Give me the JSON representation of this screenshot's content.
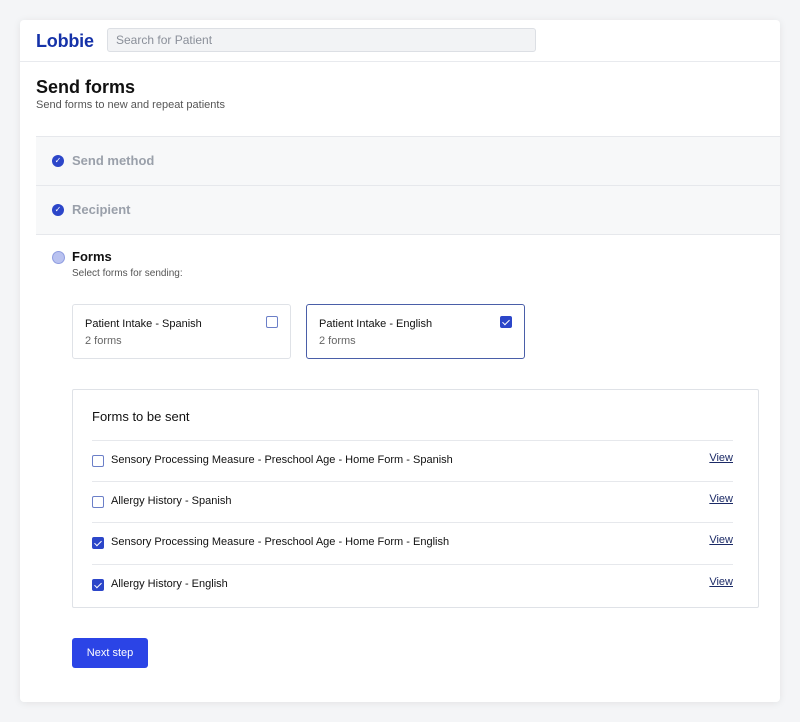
{
  "header": {
    "logo": "Lobbie",
    "search_placeholder": "Search for Patient"
  },
  "page": {
    "title": "Send forms",
    "subtitle": "Send forms to new and repeat patients"
  },
  "steps": [
    {
      "label": "Send method",
      "status": "completed"
    },
    {
      "label": "Recipient",
      "status": "completed"
    },
    {
      "label": "Forms",
      "status": "current",
      "hint": "Select forms for sending:"
    }
  ],
  "form_options": [
    {
      "name": "Patient Intake - Spanish",
      "count": "2 forms",
      "checked": false
    },
    {
      "name": "Patient Intake - English",
      "count": "2 forms",
      "checked": true
    }
  ],
  "forms_panel": {
    "title": "Forms to be sent",
    "view_label": "View",
    "items": [
      {
        "label": "Sensory Processing Measure - Preschool Age - Home Form - Spanish",
        "checked": false
      },
      {
        "label": "Allergy History - Spanish",
        "checked": false
      },
      {
        "label": "Sensory Processing Measure - Preschool Age - Home Form - English",
        "checked": true
      },
      {
        "label": "Allergy History - English",
        "checked": true
      }
    ]
  },
  "actions": {
    "next_label": "Next step"
  },
  "colors": {
    "brand": "#1532a8",
    "accent": "#2c46c9",
    "button": "#2b44e6"
  },
  "icons": {
    "step_done": "check-circle-icon",
    "step_current": "circle-icon",
    "checkbox_checked": "checkbox-checked-icon",
    "checkbox_empty": "checkbox-empty-icon"
  }
}
